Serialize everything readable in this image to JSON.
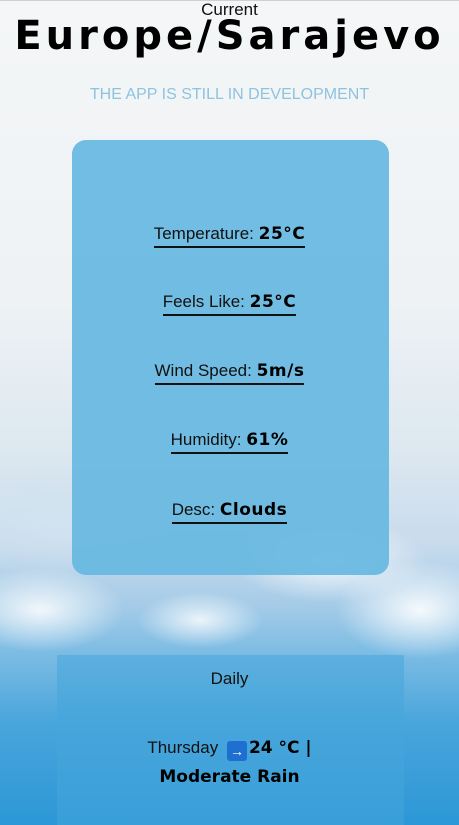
{
  "header": {
    "title": "Europe/Sarajevo",
    "subtitle": "THE APP IS STILL IN DEVELOPMENT"
  },
  "current": {
    "heading": "Current",
    "temperature": {
      "label": "Temperature:",
      "value": "25°C"
    },
    "feels_like": {
      "label": "Feels Like:",
      "value": "25°C"
    },
    "wind_speed": {
      "label": "Wind Speed:",
      "value": "5m/s"
    },
    "humidity": {
      "label": "Humidity:",
      "value": "61%"
    },
    "desc": {
      "label": "Desc:",
      "value": "Clouds"
    }
  },
  "daily": {
    "heading": "Daily",
    "days": [
      {
        "day": "Thursday",
        "icon": "arrow-right-icon",
        "arrow": "→",
        "temp": "24 °C |",
        "desc": "Moderate Rain"
      }
    ]
  },
  "colors": {
    "subtitle": "#8ec3e0",
    "card_current": "#67b8e1",
    "icon_background": "#1e6fd0"
  }
}
